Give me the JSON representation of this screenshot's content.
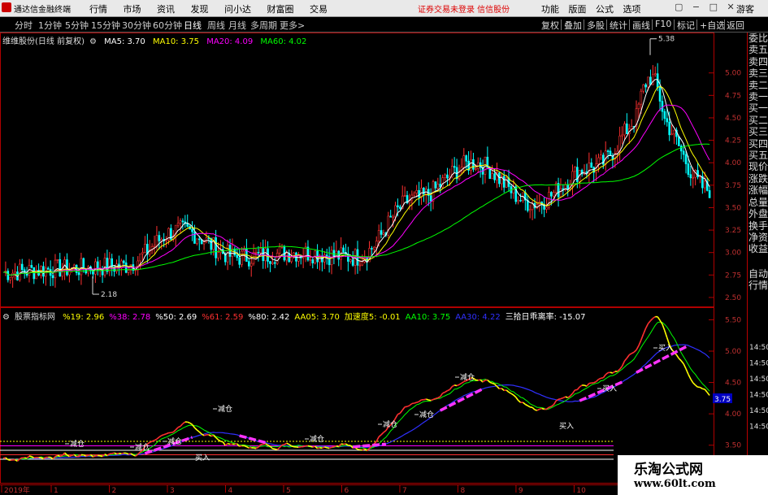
{
  "window": {
    "title": "通达信金融终端",
    "menu": [
      "行情",
      "市场",
      "资讯",
      "发现",
      "问小达",
      "财富圈",
      "交易"
    ],
    "broker": "证券交易未登录 信信股份",
    "right_menu": [
      "功能",
      "版面",
      "公式",
      "选项"
    ],
    "window_controls": "▢ − □ ✕",
    "guest": "游客"
  },
  "periods": [
    "分时",
    "1分钟",
    "5分钟",
    "15分钟",
    "30分钟",
    "60分钟",
    "日线",
    "周线",
    "月线",
    "多周期",
    "更多>"
  ],
  "selected_period": "日线",
  "tools": [
    "复权",
    "叠加",
    "多股",
    "统计",
    "画线",
    "F10",
    "标记",
    "+自选",
    "返回"
  ],
  "main_legend": {
    "stock": "维维股份(日线 前复权)",
    "items": [
      {
        "text": "MA5: 3.70",
        "color": "#ffffff"
      },
      {
        "text": "MA10: 3.75",
        "color": "#ffff00"
      },
      {
        "text": "MA20: 4.09",
        "color": "#ff00ff"
      },
      {
        "text": "MA60: 4.02",
        "color": "#00ff00"
      }
    ]
  },
  "sub_legend": {
    "name": "股票指标网",
    "items": [
      {
        "text": "%19: 2.96",
        "color": "#ffff00"
      },
      {
        "text": "%38: 2.78",
        "color": "#ff00ff"
      },
      {
        "text": "%50: 2.69",
        "color": "#ffffff"
      },
      {
        "text": "%61: 2.59",
        "color": "#ff3030"
      },
      {
        "text": "%80: 2.42",
        "color": "#ffffff"
      },
      {
        "text": "AA05: 3.70",
        "color": "#ffff00"
      },
      {
        "text": "加速度5: -0.01",
        "color": "#ffff00"
      },
      {
        "text": "AA10: 3.75",
        "color": "#00ff00"
      },
      {
        "text": "AA30: 4.22",
        "color": "#3030ff"
      },
      {
        "text": "三拾日乖离率: -15.07",
        "color": "#ffffff"
      }
    ]
  },
  "sidebar": [
    "委比",
    "卖五",
    "卖四",
    "卖三",
    "卖二",
    "卖一",
    "买一",
    "买二",
    "买三",
    "买四",
    "买五",
    "现价",
    "涨跌",
    "涨幅",
    "总量",
    "外盘",
    "换手",
    "净资",
    "收益",
    "",
    "自动",
    "行情"
  ],
  "price_axis": [
    "5.00",
    "4.75",
    "4.50",
    "4.25",
    "4.00",
    "3.75",
    "3.50",
    "3.25",
    "3.00",
    "2.75",
    "2.50"
  ],
  "sub_axis": [
    "5.50",
    "5.00",
    "4.50",
    "4.00",
    "3.50",
    "3.00"
  ],
  "sub_axis_overlap": [
    "14:50",
    "14:50",
    "14:50",
    "14:50",
    "14:50",
    "14:50"
  ],
  "current_value_tag": "3.75",
  "high_label": "5.38",
  "low_label": "2.18",
  "sub_annotations": [
    "减仓",
    "减仓",
    "减仓",
    "减仓",
    "减仓",
    "减仓",
    "减仓",
    "减仓",
    "买入",
    "买入"
  ],
  "months": [
    "2019年",
    "1",
    "2",
    "3",
    "4",
    "5",
    "6",
    "7",
    "8",
    "9",
    "10",
    "11",
    "1"
  ],
  "watermark": {
    "line1": "乐淘公式网",
    "line2": "www.60lt.com"
  },
  "colors": {
    "up": "#ff3030",
    "down": "#00ffff",
    "ma5": "#ffffff",
    "ma10": "#ffff00",
    "ma20": "#ff00ff",
    "ma60": "#00ff00",
    "frame": "#b00000"
  },
  "chart_data": {
    "type": "candlestick",
    "title": "维维股份(日线 前复权)",
    "price_ylim": [
      2.4,
      5.45
    ],
    "high": 5.38,
    "low": 2.18,
    "close_path": [
      {
        "x": "2019-01",
        "y": 2.78
      },
      {
        "x": "2019-02",
        "y": 2.82
      },
      {
        "x": "2019-03",
        "y": 2.85
      },
      {
        "x": "2019-04",
        "y": 3.25
      },
      {
        "x": "2019-05",
        "y": 2.95
      },
      {
        "x": "2019-06",
        "y": 3.0
      },
      {
        "x": "2019-07",
        "y": 2.95
      },
      {
        "x": "2019-08",
        "y": 3.6
      },
      {
        "x": "2019-09",
        "y": 4.0
      },
      {
        "x": "2019-10",
        "y": 3.55
      },
      {
        "x": "2019-11",
        "y": 3.95
      },
      {
        "x": "2019-12",
        "y": 4.6
      },
      {
        "x": "2020-01",
        "y": 3.7
      }
    ],
    "ma_last": {
      "MA5": 3.7,
      "MA10": 3.75,
      "MA20": 4.09,
      "MA60": 4.02
    },
    "indicator_ylim": [
      2.9,
      5.7
    ]
  }
}
